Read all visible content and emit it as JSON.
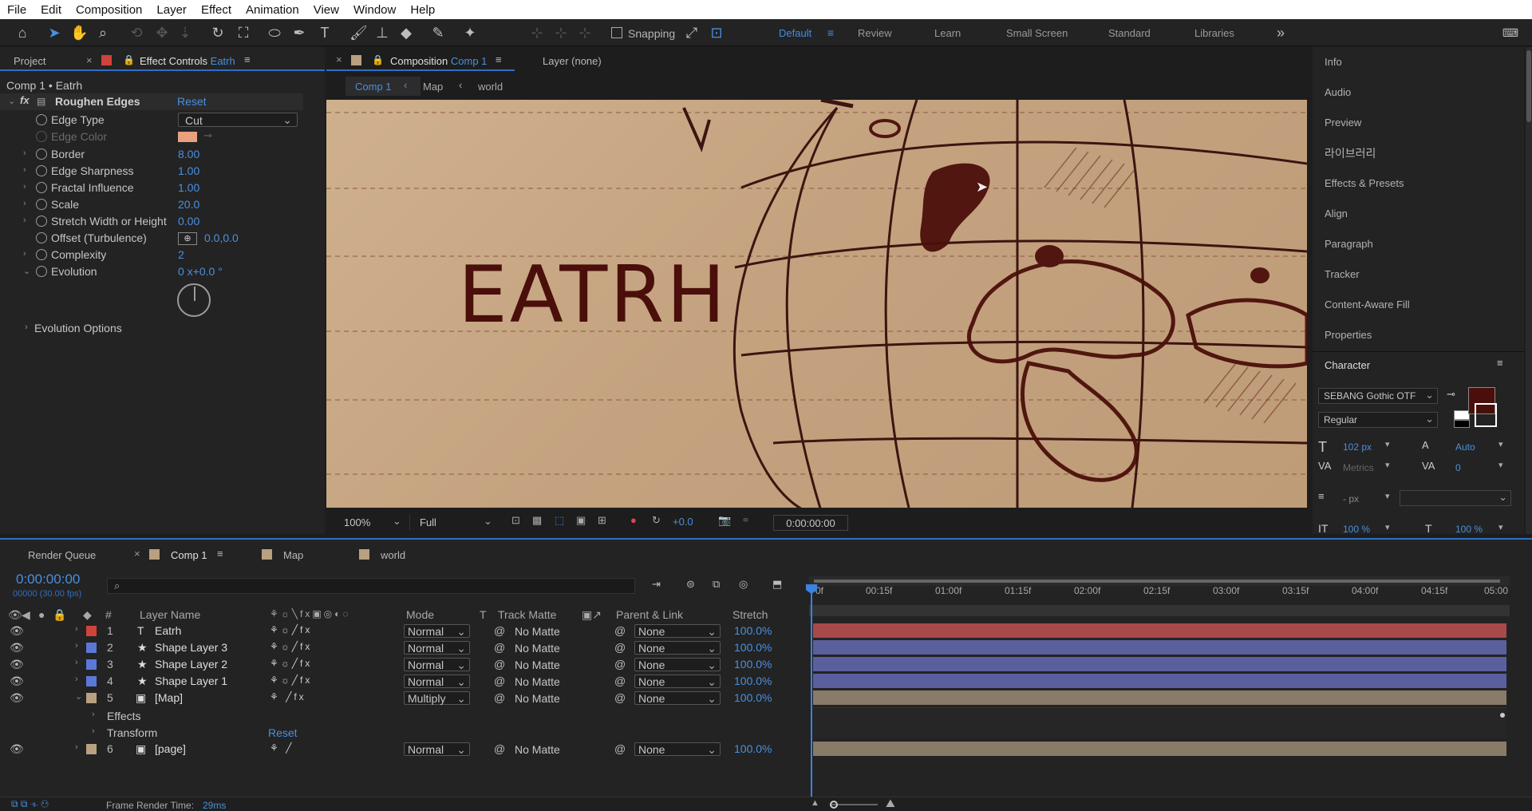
{
  "menu": [
    "File",
    "Edit",
    "Composition",
    "Layer",
    "Effect",
    "Animation",
    "View",
    "Window",
    "Help"
  ],
  "toolbar": {
    "snapping": "Snapping"
  },
  "workspaces": [
    "Default",
    "Review",
    "Learn",
    "Small Screen",
    "Standard",
    "Libraries"
  ],
  "effect_panel": {
    "tab_project": "Project",
    "tab_effect": "Effect Controls",
    "tab_effect_sub": "Eatrh",
    "breadcrumb": "Comp 1 • Eatrh",
    "effect_name": "Roughen Edges",
    "reset": "Reset",
    "edge_type_label": "Edge Type",
    "edge_type_value": "Cut",
    "edge_color_label": "Edge Color",
    "props": [
      {
        "name": "Border",
        "value": "8.00"
      },
      {
        "name": "Edge Sharpness",
        "value": "1.00"
      },
      {
        "name": "Fractal Influence",
        "value": "1.00"
      },
      {
        "name": "Scale",
        "value": "20.0"
      },
      {
        "name": "Stretch Width or Height",
        "value": "0.00"
      },
      {
        "name": "Offset (Turbulence)",
        "value": "0.0,0.0"
      },
      {
        "name": "Complexity",
        "value": "2"
      },
      {
        "name": "Evolution",
        "value": "0 x+0.0 °"
      }
    ],
    "evolution_options": "Evolution Options"
  },
  "comp_panel": {
    "tab_label": "Composition",
    "tab_sub": "Comp 1",
    "layer_tab": "Layer (none)",
    "crumbs": [
      "Comp 1",
      "Map",
      "world"
    ],
    "canvas_text": "EATRH",
    "zoom": "100%",
    "resolution": "Full",
    "exposure": "+0.0",
    "timecode": "0:00:00:00"
  },
  "right_panel": {
    "items": [
      "Info",
      "Audio",
      "Preview",
      "라이브러리",
      "Effects & Presets",
      "Align",
      "Paragraph",
      "Tracker",
      "Content-Aware Fill",
      "Properties"
    ],
    "character": {
      "title": "Character",
      "font": "SEBANG Gothic OTF",
      "style": "Regular",
      "size": "102 px",
      "leading": "Auto",
      "kerning": "Metrics",
      "tracking": "0",
      "stroke": "- px",
      "vscale": "100 %",
      "hscale": "100 %"
    },
    "fill_color": "#4a0f0a"
  },
  "timeline": {
    "tabs": [
      "Render Queue",
      "Comp 1",
      "Map",
      "world"
    ],
    "time": "0:00:00:00",
    "frames": "00000 (30.00 fps)",
    "headers": {
      "num": "#",
      "name": "Layer Name",
      "mode": "Mode",
      "t": "T",
      "matte": "Track Matte",
      "parent": "Parent & Link",
      "stretch": "Stretch"
    },
    "ruler": [
      "0f",
      "00:15f",
      "01:00f",
      "01:15f",
      "02:00f",
      "02:15f",
      "03:00f",
      "03:15f",
      "04:00f",
      "04:15f",
      "05:00"
    ],
    "layers": [
      {
        "num": "1",
        "name": "Eatrh",
        "type": "T",
        "color": "#d0433a",
        "mode": "Normal",
        "matte": "No Matte",
        "parent": "None",
        "stretch": "100.0%",
        "bar": "#a8494a"
      },
      {
        "num": "2",
        "name": "Shape Layer 3",
        "type": "★",
        "color": "#5a78d8",
        "mode": "Normal",
        "matte": "No Matte",
        "parent": "None",
        "stretch": "100.0%",
        "bar": "#5a5f9e"
      },
      {
        "num": "3",
        "name": "Shape Layer 2",
        "type": "★",
        "color": "#5a78d8",
        "mode": "Normal",
        "matte": "No Matte",
        "parent": "None",
        "stretch": "100.0%",
        "bar": "#5a5f9e"
      },
      {
        "num": "4",
        "name": "Shape Layer 1",
        "type": "★",
        "color": "#5a78d8",
        "mode": "Normal",
        "matte": "No Matte",
        "parent": "None",
        "stretch": "100.0%",
        "bar": "#5a5f9e"
      },
      {
        "num": "5",
        "name": "[Map]",
        "type": "▣",
        "color": "#b8a080",
        "mode": "Multiply",
        "matte": "No Matte",
        "parent": "None",
        "stretch": "100.0%",
        "bar": "#8a7a68"
      }
    ],
    "sub_effects": "Effects",
    "sub_transform": "Transform",
    "sub_reset": "Reset",
    "layer6": {
      "num": "6",
      "name": "[page]",
      "type": "▣",
      "color": "#b8a080",
      "mode": "Normal",
      "matte": "No Matte",
      "parent": "None",
      "stretch": "100.0%",
      "bar": "#8a7a68"
    },
    "render_time_label": "Frame Render Time:",
    "render_time": "29ms"
  }
}
